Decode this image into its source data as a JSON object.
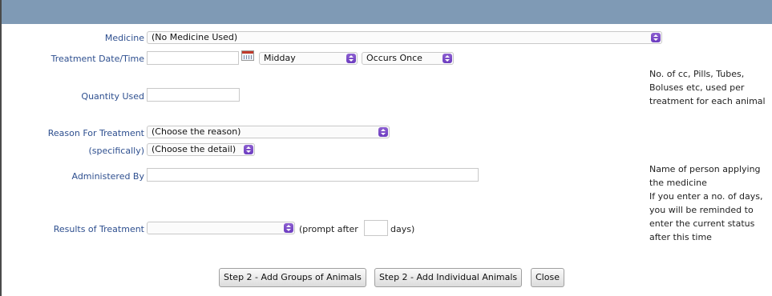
{
  "form": {
    "medicine": {
      "label": "Medicine",
      "value": "(No Medicine Used)"
    },
    "treatment_datetime": {
      "label": "Treatment Date/Time",
      "date_value": "",
      "time_value": "Midday",
      "occurrence_value": "Occurs Once"
    },
    "quantity": {
      "label": "Quantity Used",
      "value": ""
    },
    "reason": {
      "label": "Reason For Treatment",
      "value": "(Choose the reason)"
    },
    "specifically": {
      "label": "(specifically)",
      "value": "(Choose the detail)"
    },
    "administered_by": {
      "label": "Administered By",
      "value": ""
    },
    "results": {
      "label": "Results of Treatment",
      "value": "",
      "prompt_prefix": "(prompt after",
      "prompt_days": "",
      "prompt_suffix": "days)"
    }
  },
  "help": {
    "quantity": "No. of cc, Pills, Tubes, Boluses etc, used per treatment for each animal",
    "administered_by": "Name of person applying the medicine",
    "prompt": "If you enter a no. of days, you will be reminded to enter the current status after this time"
  },
  "buttons": {
    "add_groups": "Step 2 - Add Groups of Animals",
    "add_individual": "Step 2 - Add Individual Animals",
    "close": "Close"
  },
  "icons": {
    "calendar": "calendar-icon",
    "select_arrow": "select-arrows-icon"
  },
  "colors": {
    "header": "#7f9ab5",
    "label": "#2e4f8f",
    "select_arrow": "#7a4bcf"
  }
}
